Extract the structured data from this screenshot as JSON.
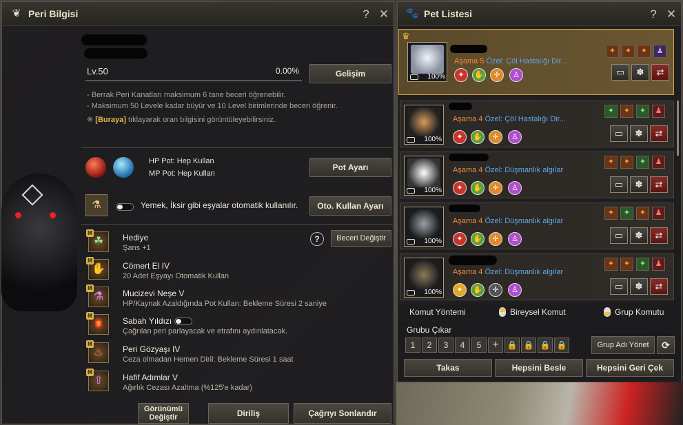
{
  "left_panel": {
    "title": "Peri Bilgisi",
    "help": "?",
    "close": "✕",
    "level": "Lv.50",
    "percent": "0.00%",
    "evolve_btn": "Gelişim",
    "notes": [
      "- Berrak Peri Kanatları maksimum 6 tane beceri öğrenebilir.",
      "- Maksimum 50 Levele kadar büyür ve 10 Level birimlerinde beceri öğrenir."
    ],
    "note3_prefix": "※",
    "note3_link": "[Buraya]",
    "note3_rest": " tıklayarak oran bilgisini görüntüleyebilirsiniz.",
    "hp_pot": "HP Pot: Hep Kullan",
    "mp_pot": "MP Pot: Hep Kullan",
    "pot_btn": "Pot Ayarı",
    "auto_text": "Yemek, İksir gibi eşyalar otomatik kullanılır.",
    "auto_btn": "Oto. Kullan Ayarı",
    "skill_change_btn": "Beceri Değiştir",
    "skill_help": "?",
    "skills": [
      {
        "name": "Hediye",
        "desc": "Şans +1"
      },
      {
        "name": "Cömert El IV",
        "desc": "20 Adet Eşyayı Otomatik Kullan"
      },
      {
        "name": "Mucizevi Neşe V",
        "desc": "HP/Kaynak Azaldığında Pot Kullan: Bekleme Süresi 2 saniye"
      },
      {
        "name": "Sabah Yıldızı",
        "desc": "Çağrılan peri parlayacak ve etrafını aydınlatacak."
      },
      {
        "name": "Peri Gözyaşı IV",
        "desc": "Ceza olmadan Hemen Diril: Bekleme Süresi 1 saat"
      },
      {
        "name": "Hafif Adımlar V",
        "desc": "Ağırlık Cezası Azaltma (%125'e kadar)"
      }
    ],
    "m_badge": "M",
    "btn_look": "Görünümü Değiştir",
    "btn_revive": "Diriliş",
    "btn_end": "Çağrıyı Sonlandır"
  },
  "right_panel": {
    "title": "Pet Listesi",
    "help": "?",
    "close": "✕",
    "pets": [
      {
        "stage_label": "Aşama 5",
        "special": "Özel: Çöl Hastalığı Dir...",
        "pct": "100%",
        "selected": true,
        "fur": "#e8ecf0"
      },
      {
        "stage_label": "Aşama 4",
        "special": "Özel: Çöl Hastalığı Dir...",
        "pct": "100%",
        "selected": false,
        "fur": "#c98a4a"
      },
      {
        "stage_label": "Aşama 4",
        "special": "Özel: Düşmanlık algılar",
        "pct": "100%",
        "selected": false,
        "fur": "#f2f2f2"
      },
      {
        "stage_label": "Aşama 4",
        "special": "Özel: Düşmanlık algılar",
        "pct": "100%",
        "selected": false,
        "fur": "#7a7f86"
      },
      {
        "stage_label": "Aşama 4",
        "special": "Özel: Düşmanlık algılar",
        "pct": "100%",
        "selected": false,
        "fur": "#6b6050"
      }
    ],
    "cmd_method": "Komut Yöntemi",
    "cmd_individual": "Bireysel Komut",
    "cmd_group": "Grup Komutu",
    "group_out": "Grubu Çıkar",
    "group_nums": [
      "1",
      "2",
      "3",
      "4",
      "5"
    ],
    "group_name_btn": "Grup Adı Yönet",
    "btn_trade": "Takas",
    "btn_feed": "Hepsini Besle",
    "btn_recall": "Hepsini Geri Çek"
  }
}
